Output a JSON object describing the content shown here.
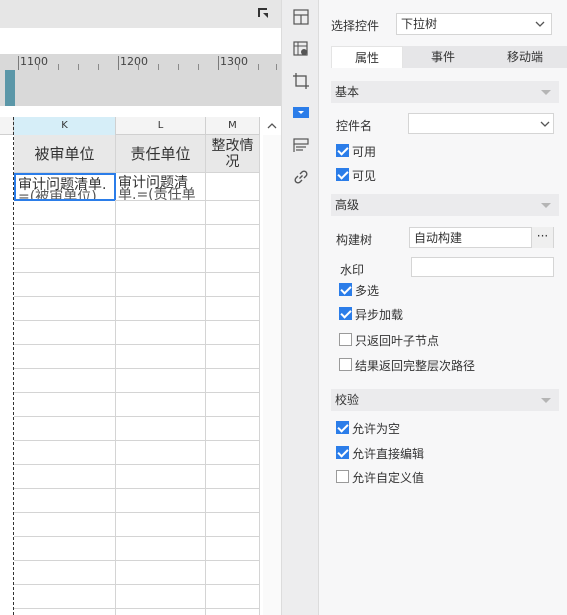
{
  "ruler": {
    "labels": [
      "1100",
      "1200",
      "1300"
    ]
  },
  "sheet": {
    "columns": [
      {
        "letter": "K"
      },
      {
        "letter": "L"
      },
      {
        "letter": "M"
      }
    ],
    "headers": [
      "被审单位",
      "责任单位",
      "整改情况"
    ],
    "row1": [
      "审计问题清单.",
      "审计问题清"
    ],
    "row1_overflow": [
      "=(被审单位)",
      "单.=(责任单"
    ]
  },
  "panel": {
    "control_label": "选择控件",
    "control_value": "下拉树",
    "tabs": [
      "属性",
      "事件",
      "移动端"
    ],
    "active_tab": 0,
    "basic": {
      "title": "基本",
      "name_label": "控件名",
      "name_value": "",
      "enabled": {
        "label": "可用",
        "checked": true
      },
      "visible": {
        "label": "可见",
        "checked": true
      }
    },
    "advanced": {
      "title": "高级",
      "build_tree_label": "构建树",
      "build_tree_value": "自动构建",
      "build_tree_button": "···",
      "watermark_label": "水印",
      "watermark_value": "",
      "options": [
        {
          "label": "多选",
          "checked": true
        },
        {
          "label": "异步加载",
          "checked": true
        },
        {
          "label": "只返回叶子节点",
          "checked": false
        },
        {
          "label": "结果返回完整层次路径",
          "checked": false
        }
      ]
    },
    "validate": {
      "title": "校验",
      "options": [
        {
          "label": "允许为空",
          "checked": true
        },
        {
          "label": "允许直接编辑",
          "checked": true
        },
        {
          "label": "允许自定义值",
          "checked": false
        }
      ]
    }
  },
  "colors": {
    "accent": "#2b7de9",
    "selected_col": "#d6eef8",
    "marker": "#5b97a8"
  }
}
